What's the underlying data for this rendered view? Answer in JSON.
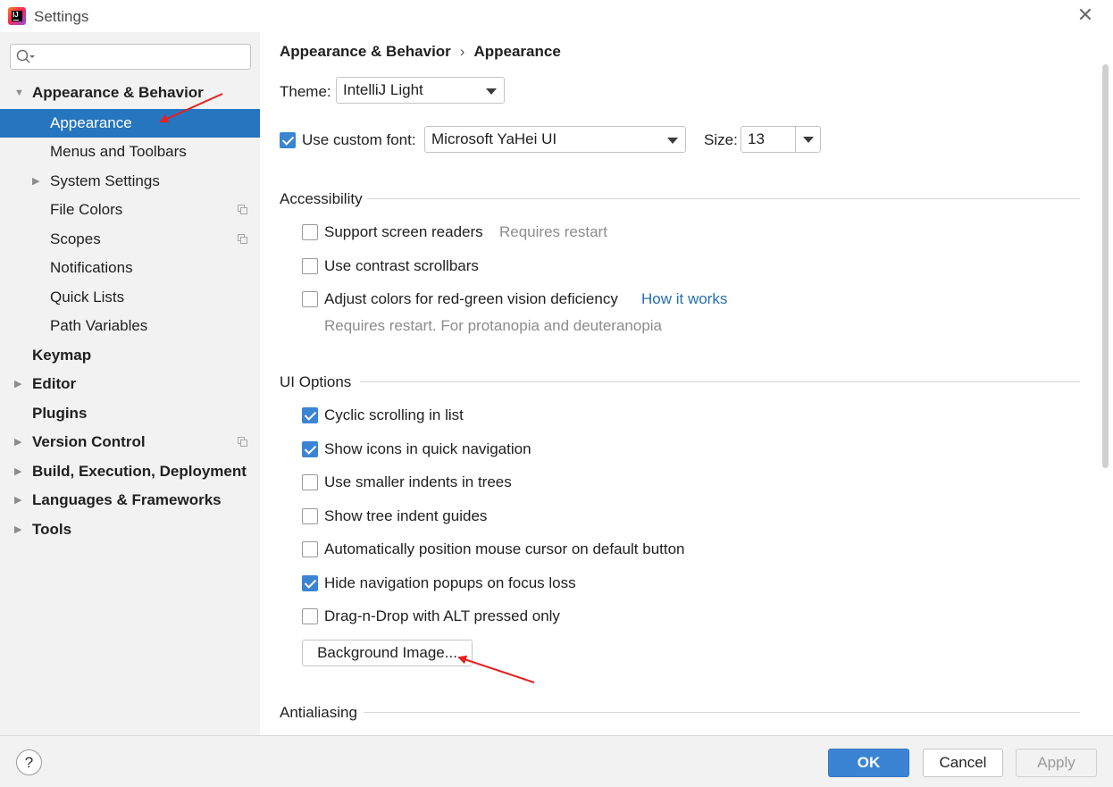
{
  "window": {
    "title": "Settings",
    "app_icon": "intellij-idea-icon",
    "close_icon": "close-icon"
  },
  "sidebar": {
    "search": {
      "value": "",
      "placeholder": "",
      "icon": "search-icon"
    },
    "items": [
      {
        "label": "Appearance & Behavior",
        "level": 0,
        "expanded": true,
        "bold": true
      },
      {
        "label": "Appearance",
        "level": 1,
        "selected": true
      },
      {
        "label": "Menus and Toolbars",
        "level": 1
      },
      {
        "label": "System Settings",
        "level": 1,
        "expandable": true
      },
      {
        "label": "File Colors",
        "level": 1,
        "copy_icon": true
      },
      {
        "label": "Scopes",
        "level": 1,
        "copy_icon": true
      },
      {
        "label": "Notifications",
        "level": 1
      },
      {
        "label": "Quick Lists",
        "level": 1
      },
      {
        "label": "Path Variables",
        "level": 1
      },
      {
        "label": "Keymap",
        "level": 0,
        "bold": true
      },
      {
        "label": "Editor",
        "level": 0,
        "bold": true,
        "expandable": true
      },
      {
        "label": "Plugins",
        "level": 0,
        "bold": true
      },
      {
        "label": "Version Control",
        "level": 0,
        "bold": true,
        "expandable": true,
        "copy_icon": true
      },
      {
        "label": "Build, Execution, Deployment",
        "level": 0,
        "bold": true,
        "expandable": true
      },
      {
        "label": "Languages & Frameworks",
        "level": 0,
        "bold": true,
        "expandable": true
      },
      {
        "label": "Tools",
        "level": 0,
        "bold": true,
        "expandable": true
      }
    ]
  },
  "breadcrumb": {
    "parent": "Appearance & Behavior",
    "separator": "›",
    "current": "Appearance"
  },
  "theme": {
    "label": "Theme:",
    "value": "IntelliJ Light"
  },
  "font": {
    "checkbox_label": "Use custom font:",
    "checked": true,
    "value": "Microsoft YaHei UI",
    "size_label": "Size:",
    "size_value": "13"
  },
  "accessibility": {
    "title": "Accessibility",
    "support_screen_readers": {
      "label": "Support screen readers",
      "checked": false,
      "note": "Requires restart"
    },
    "contrast_scrollbars": {
      "label": "Use contrast scrollbars",
      "checked": false
    },
    "red_green": {
      "label": "Adjust colors for red-green vision deficiency",
      "checked": false,
      "link": "How it works",
      "note": "Requires restart. For protanopia and deuteranopia"
    }
  },
  "ui_options": {
    "title": "UI Options",
    "options": [
      {
        "label": "Cyclic scrolling in list",
        "checked": true
      },
      {
        "label": "Show icons in quick navigation",
        "checked": true
      },
      {
        "label": "Use smaller indents in trees",
        "checked": false
      },
      {
        "label": "Show tree indent guides",
        "checked": false
      },
      {
        "label": "Automatically position mouse cursor on default button",
        "checked": false
      },
      {
        "label": "Hide navigation popups on focus loss",
        "checked": true
      },
      {
        "label": "Drag-n-Drop with ALT pressed only",
        "checked": false
      }
    ],
    "background_image_button": "Background Image..."
  },
  "antialiasing": {
    "title": "Antialiasing"
  },
  "footer": {
    "help": "?",
    "ok": "OK",
    "cancel": "Cancel",
    "apply": "Apply"
  },
  "colors": {
    "selection": "#2675bf",
    "checkbox_checked": "#3b84d4",
    "link": "#2470b3",
    "annotation_arrow": "#e8201c"
  }
}
